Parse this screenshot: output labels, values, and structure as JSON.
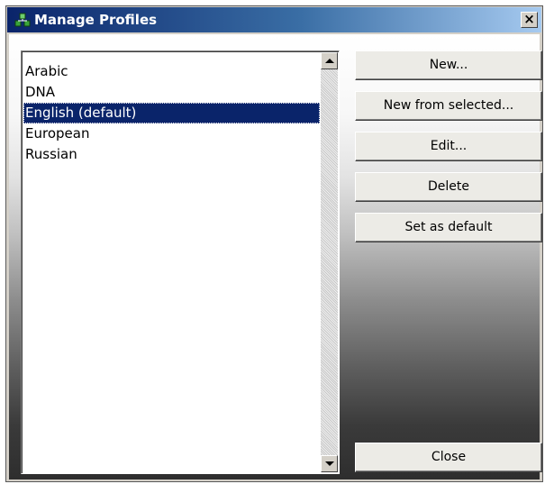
{
  "window": {
    "title": "Manage Profiles",
    "close_glyph": "×"
  },
  "profiles": {
    "items": [
      "Arabic",
      "DNA",
      "English (default)",
      "European",
      "Russian"
    ],
    "selected_index": 2
  },
  "buttons": {
    "new_label": "New...",
    "new_from_selected_label": "New from selected...",
    "edit_label": "Edit...",
    "delete_label": "Delete",
    "set_default_label": "Set as default",
    "close_label": "Close"
  },
  "icons": {
    "title": "profiles-icon",
    "scroll_up": "arrow-up-icon",
    "scroll_down": "arrow-down-icon"
  },
  "colors": {
    "title_bar": "#0a246a",
    "selection": "#0a246a"
  }
}
